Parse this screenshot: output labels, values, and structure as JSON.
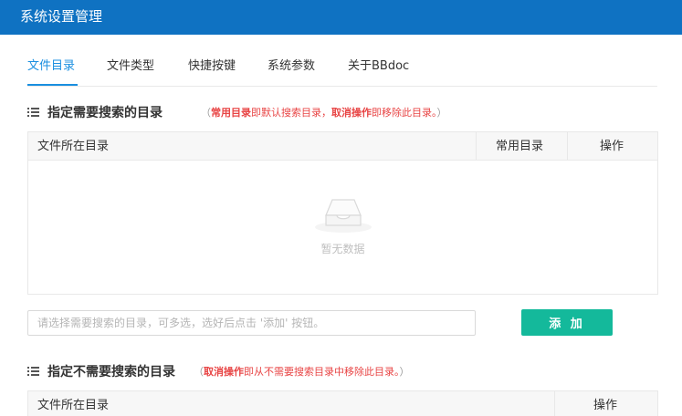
{
  "window": {
    "title": "系统设置管理"
  },
  "tabs": [
    {
      "label": "文件目录",
      "active": true
    },
    {
      "label": "文件类型",
      "active": false
    },
    {
      "label": "快捷按键",
      "active": false
    },
    {
      "label": "系统参数",
      "active": false
    },
    {
      "label": "关于BBdoc",
      "active": false
    }
  ],
  "section1": {
    "title": "指定需要搜索的目录",
    "hint": {
      "open": "（",
      "part1": "常用目录",
      "part2": "即默认搜索目录，",
      "part3": "取消操作",
      "part4": "即移除此目录。",
      "close": "）"
    },
    "columns": [
      "文件所在目录",
      "常用目录",
      "操作"
    ],
    "empty_text": "暂无数据"
  },
  "search": {
    "placeholder": "请选择需要搜索的目录，可多选，选好后点击 '添加' 按钮。",
    "value": ""
  },
  "add_button": {
    "label": "添 加"
  },
  "section2": {
    "title": "指定不需要搜索的目录",
    "hint": {
      "open": "（",
      "part1": "取消操作",
      "part2": "即从不需要搜索目录中移除此目录。",
      "close": "）"
    },
    "columns": [
      "文件所在目录",
      "操作"
    ]
  },
  "colors": {
    "header_bg": "#0f72c2",
    "accent": "#1a8fe0",
    "button": "#14b99b",
    "hint_red": "#e84545"
  },
  "icons": {
    "section": "list-icon",
    "empty": "empty-inbox-icon"
  }
}
